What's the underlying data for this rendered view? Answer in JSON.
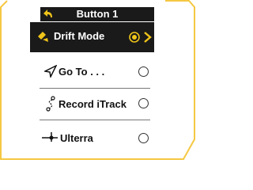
{
  "header": {
    "title": "Button 1",
    "back_icon": "back-arrow-icon"
  },
  "options": [
    {
      "label": "Drift Mode",
      "icon": "drift-mode-icon",
      "selected": true
    },
    {
      "label": "Go To . . .",
      "icon": "navigation-arrow-icon",
      "selected": false
    },
    {
      "label": "Record iTrack",
      "icon": "record-track-icon",
      "selected": false
    },
    {
      "label": "Ulterra",
      "icon": "ulterra-motor-icon",
      "selected": false
    }
  ],
  "colors": {
    "accent": "#f0c419",
    "bar": "#1a1a1a",
    "frame": "#f5c842"
  }
}
